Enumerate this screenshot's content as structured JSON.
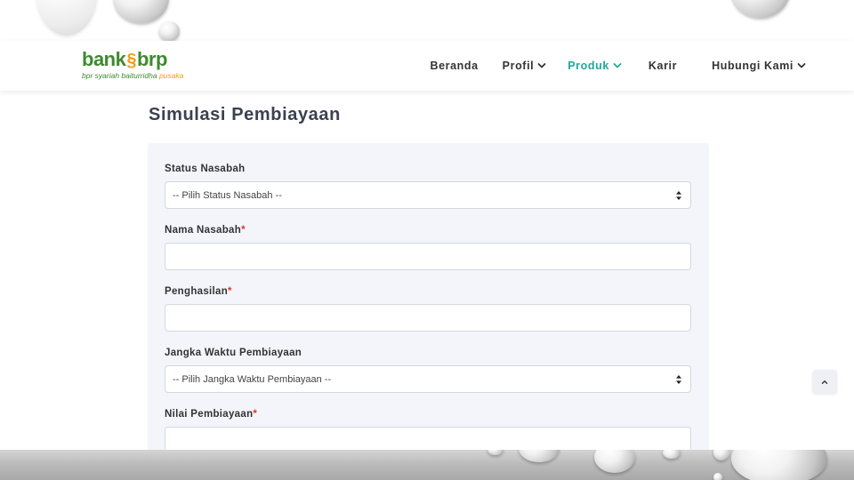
{
  "brand": {
    "logo_word_left": "bank",
    "logo_word_right": "brp",
    "tagline_main": "bpr syariah baiturridha",
    "tagline_accent": "pusaka",
    "primary_color": "#3d8a2e",
    "accent_color": "#f39c12"
  },
  "nav": {
    "active_color": "#1fa89a",
    "items": [
      {
        "label": "Beranda",
        "has_dropdown": false,
        "active": false
      },
      {
        "label": "Profil",
        "has_dropdown": true,
        "active": false
      },
      {
        "label": "Produk",
        "has_dropdown": true,
        "active": true
      },
      {
        "label": "Karir",
        "has_dropdown": false,
        "active": false
      },
      {
        "label": "Hubungi Kami",
        "has_dropdown": true,
        "active": false
      }
    ]
  },
  "page": {
    "title": "Simulasi Pembiayaan"
  },
  "form": {
    "required_marker": "*",
    "status_nasabah": {
      "label": "Status Nasabah",
      "value": "-- Pilih Status Nasabah --"
    },
    "nama_nasabah": {
      "label": "Nama Nasabah",
      "value": ""
    },
    "penghasilan": {
      "label": "Penghasilan",
      "value": ""
    },
    "jangka_waktu": {
      "label": "Jangka Waktu Pembiayaan",
      "value": "-- Pilih Jangka Waktu Pembiayaan --"
    },
    "nilai_pembiayaan": {
      "label": "Nilai Pembiayaan",
      "value": ""
    }
  },
  "icons": {
    "nav_dropdown": "chevron-down-icon",
    "select_caret": "sort-caret-icon",
    "scroll_top": "chevron-up-icon"
  }
}
